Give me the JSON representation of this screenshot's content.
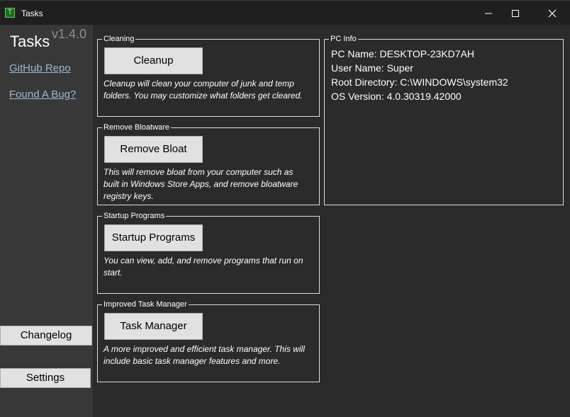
{
  "window": {
    "icon_glyph": "T",
    "title": "Tasks",
    "controls": [
      "minimize-icon",
      "maximize-icon",
      "close-icon"
    ]
  },
  "sidebar": {
    "app_name": "Tasks",
    "version": "v1.4.0",
    "links": [
      "GitHub Repo",
      "Found A Bug?"
    ],
    "changelog_label": "Changelog",
    "settings_label": "Settings"
  },
  "groups": [
    {
      "title": "Cleaning",
      "button_label": "Cleanup",
      "description": "Cleanup will clean your computer of junk  and temp folders. You may customize what folders get cleared."
    },
    {
      "title": "Remove Bloatware",
      "button_label": "Remove Bloat",
      "description": "This will remove bloat from your computer such as built in Windows Store Apps, and remove bloatware registry keys."
    },
    {
      "title": "Startup Programs",
      "button_label": "Startup Programs",
      "description": "You can view, add, and remove programs that run on start."
    },
    {
      "title": "Improved Task Manager",
      "button_label": "Task Manager",
      "description": "A more improved and efficient task manager. This will include basic task manager features and more."
    }
  ],
  "pc_info": {
    "title": "PC Info",
    "lines": [
      "PC Name: DESKTOP-23KD7AH",
      "User Name: Super",
      "Root Directory: C:\\WINDOWS\\system32",
      "OS Version: 4.0.30319.42000"
    ]
  },
  "colors": {
    "background": "#2b2b2b",
    "sidebar": "#383838",
    "titlebar": "#1f1f1f",
    "button": "#e1e1e1",
    "link": "#9fb8d4"
  }
}
